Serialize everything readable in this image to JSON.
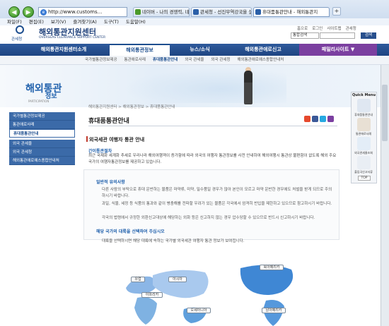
{
  "browser": {
    "address": "http://www.customs...",
    "tabs": [
      "네이버 - 나의 경쟁력, 네이버",
      "관세청 - 선진무역강국을 실",
      "휴대품통관안내 - 해외통관지"
    ],
    "menu": [
      "파일(F)",
      "편집(E)",
      "보기(V)",
      "즐겨찾기(A)",
      "도구(T)",
      "도움말(H)"
    ],
    "nav_icons": [
      "back-icon",
      "forward-icon"
    ]
  },
  "header": {
    "logo_text": "관세청",
    "site_title": "해외통관지원센터",
    "site_en": "OVERSEAS CLEARANCE SUPPORT CENTER",
    "util_links": [
      "홈으로",
      "로그인",
      "사이트맵",
      "관세청"
    ],
    "search_select": "통합검색",
    "search_button": "검색"
  },
  "gnb": {
    "items": [
      "해외통관지원센터소개",
      "해외통관정보",
      "뉴스/소식",
      "해외통관애로신고"
    ],
    "family_site": "패밀리사이트",
    "active_index": 1
  },
  "subnav": [
    "국가별통관정보제공",
    "통관애로사례",
    "휴대품통관안내",
    "외국 관세율",
    "외국 관세청",
    "해외통관애로예스종합안내처"
  ],
  "sidebar": {
    "title_line1": "해외통관",
    "title_line2": "정보",
    "title_en": "PARTICIPATION",
    "items": [
      "국가별통관정보제공",
      "통관애로사례",
      "휴대품통관안내",
      "외국 관세율",
      "외국 관세청",
      "해외통관애로예스종합안내처"
    ],
    "active_index": 2
  },
  "content": {
    "breadcrumb": "해외통관지원센터 > 해외통관정보 > 휴대품통관안내",
    "page_title": "휴대품통관안내",
    "section_title": "외국세관 여행자 통관 안내",
    "sub_title": "간이통관절차",
    "intro": "최근 국제화 세계화 추세로 우리나라 해외여행객이 증가함에 따라 외국의 여행자 통관정보를 사전 안내하여 해외여행시 통관상 불편함이 없도록 해외 주요국가의 여행자통관정보를 제공하고 있습니다.",
    "note_head": "일반적 유의사항",
    "bullets": [
      "다른 사람의 부탁으로 휴대 운반하는 물품은 마약류, 미약, 밀수품일 경우가 많아 본인이 모르고 마약 운반한 경우에도 처벌을 받게 되므로 주의하시기 바랍니다.",
      "과일, 식물, 세정 등 식품의 통과와 같이 병충해를 전파할 우려가 있는 물품은 각국에서 엄격히 반입을 제한하고 있으므로 참고하시기 바랍니다.",
      "각국의 법령에서 규정한 외환신고대상에 해당하는 외화 등은 신고하지 않는 경우 압수당할 수 있으므로 반드시 신고하시기 바랍니다."
    ],
    "select_title": "해당 국가의 대륙을 선택하여 주십시오",
    "select_desc": "대륙을 선택하시면 해당 대륙에 속하는 국가별 외국세관 여행자 통관 정보가 보여집니다."
  },
  "map": {
    "regions": [
      "유럽",
      "아시아",
      "북아메리카",
      "아프리카",
      "오세아니아",
      "남아메리카"
    ]
  },
  "quick_menu": {
    "title": "Quick Menu",
    "items": [
      "휴대품통관안내",
      "통관애로사례",
      "외국관세율조회",
      "출입국신고서류"
    ],
    "top": "TOP"
  },
  "colors": {
    "nav_blue": "#1f4582",
    "family_purple": "#7b3fa0",
    "accent_blue": "#2262ad",
    "section_red": "#c0392b"
  }
}
